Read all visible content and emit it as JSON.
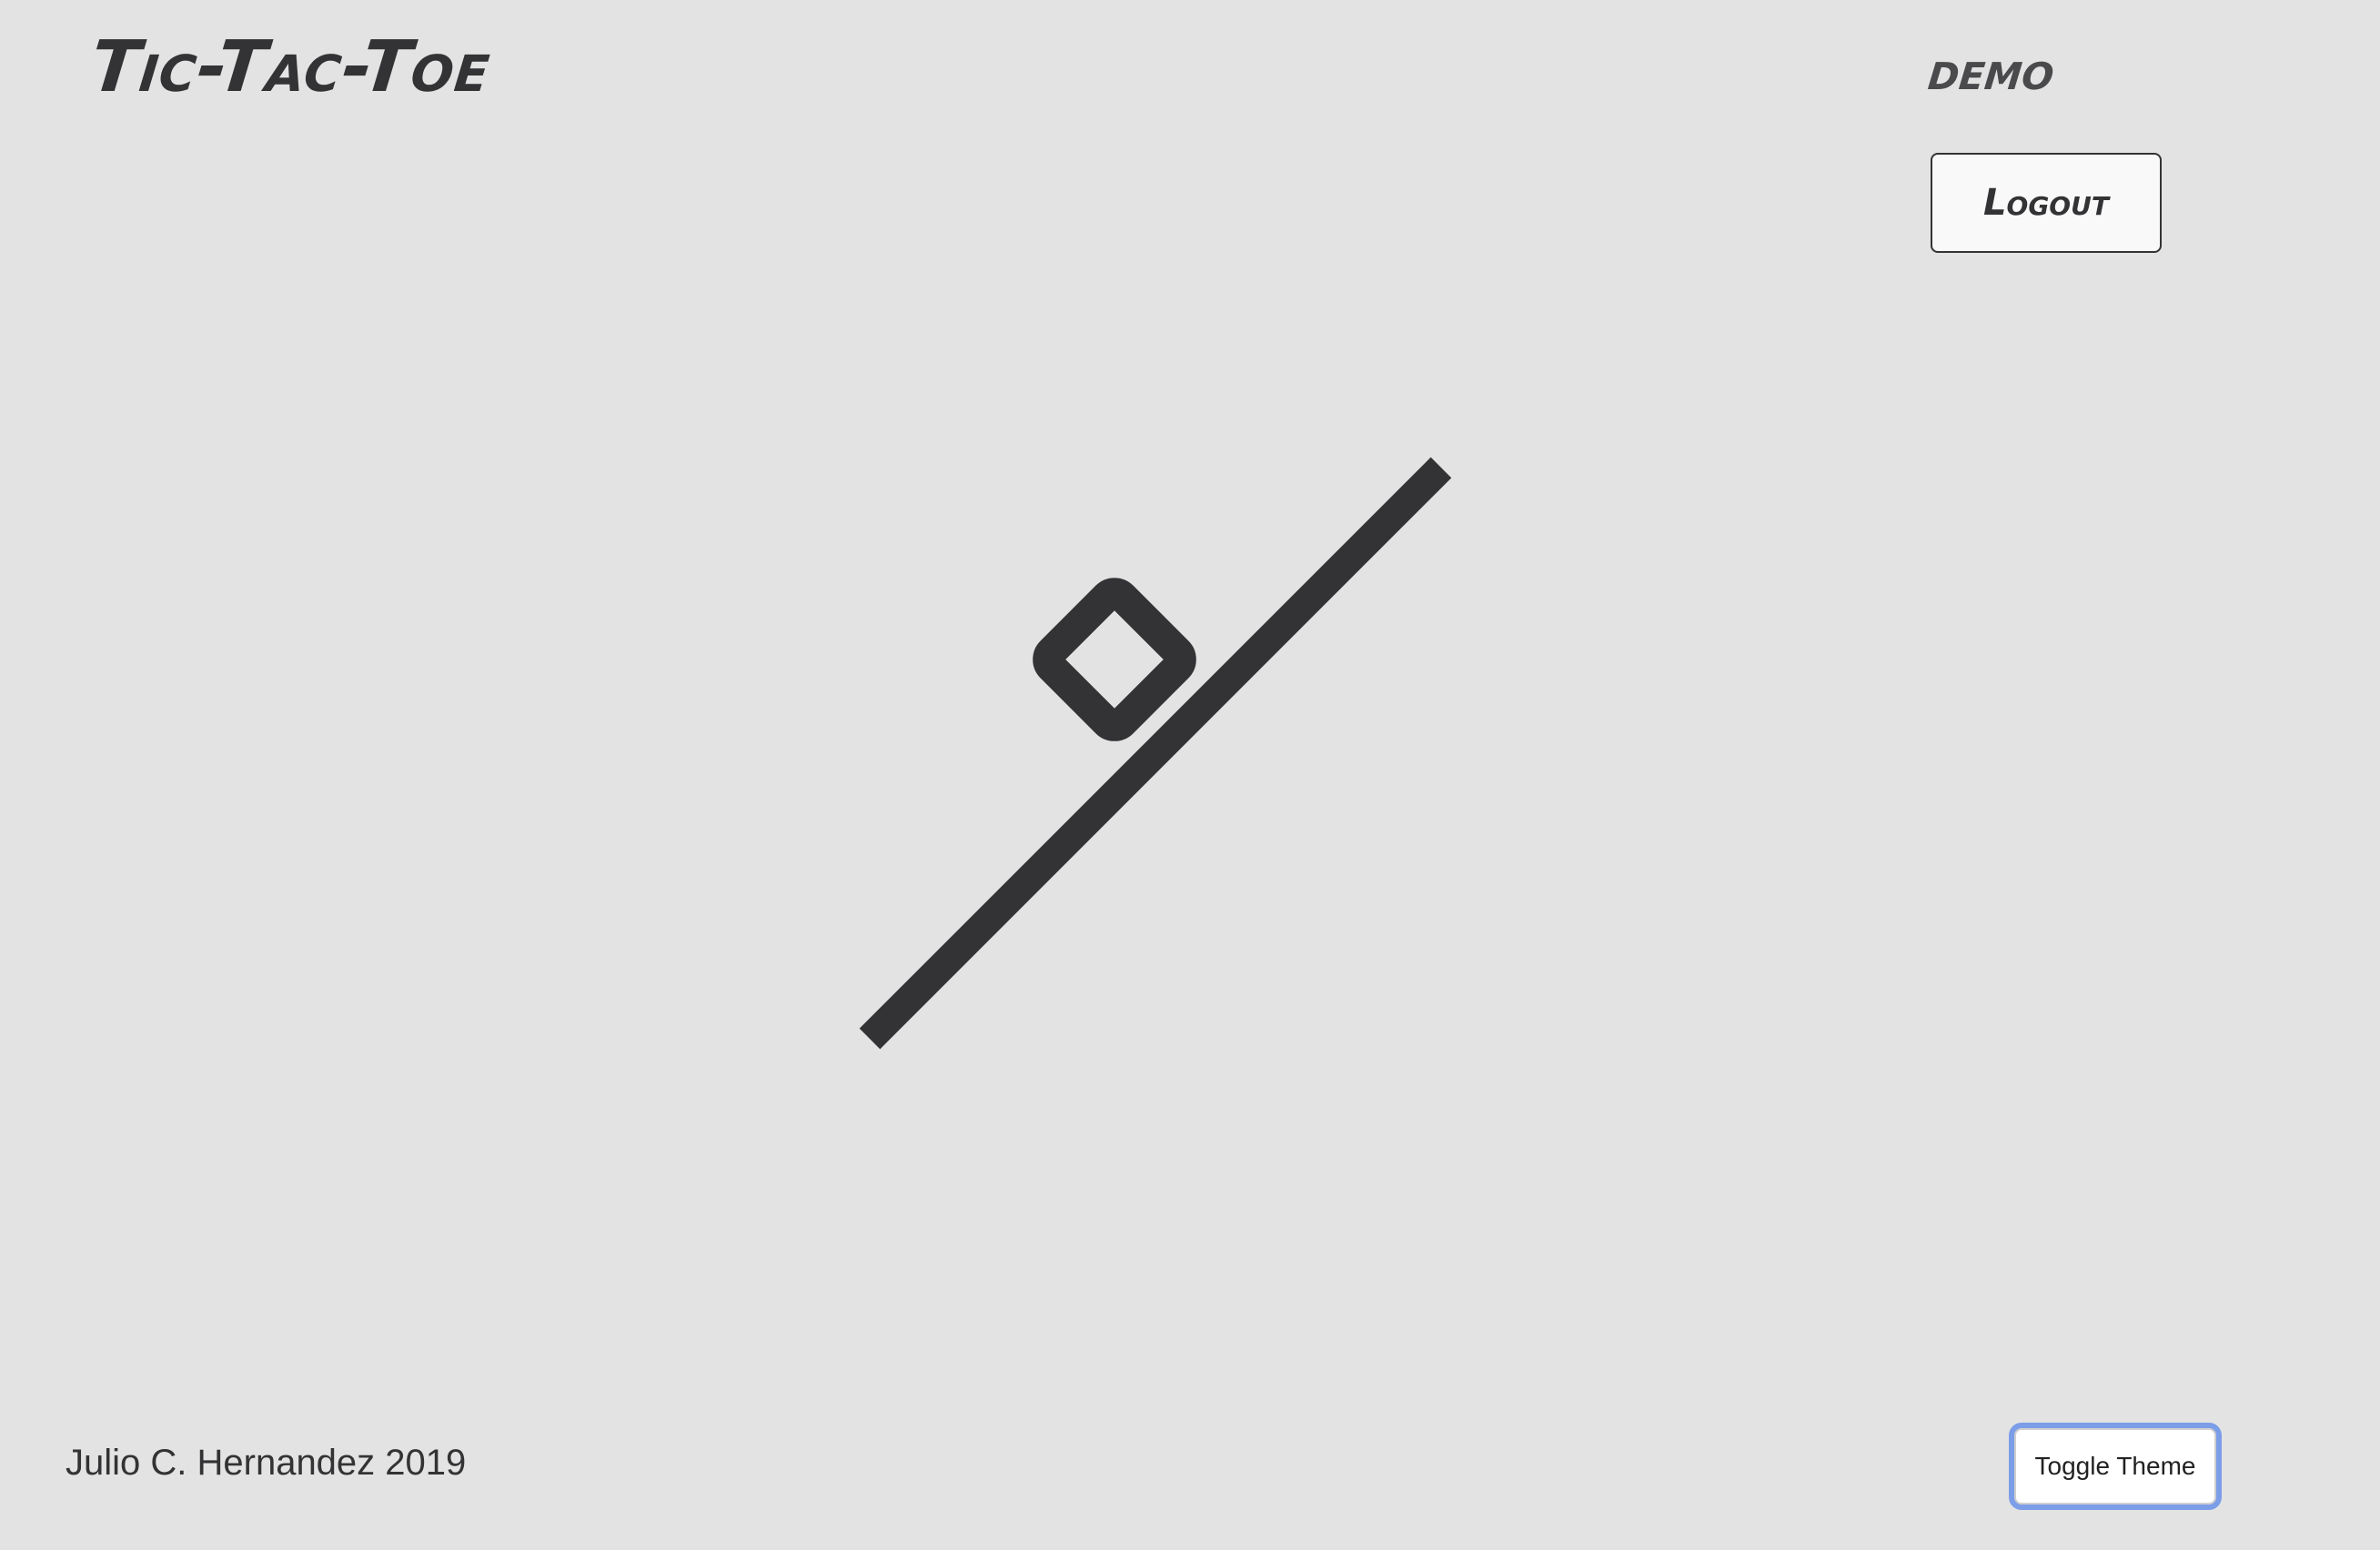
{
  "header": {
    "title": "Tic-Tac-Toe",
    "username": "demo",
    "logout_label": "Logout"
  },
  "board": {
    "marks": [
      {
        "type": "O",
        "icon": "o-mark-icon"
      },
      {
        "type": "strike",
        "icon": "win-strike-line"
      }
    ],
    "mark_color": "#333335"
  },
  "footer": {
    "credit": "Julio C. Hernandez 2019",
    "toggle_theme_label": "Toggle Theme"
  },
  "colors": {
    "background": "#e3e3e3",
    "text": "#333335",
    "focus_ring": "#7c9de8"
  }
}
